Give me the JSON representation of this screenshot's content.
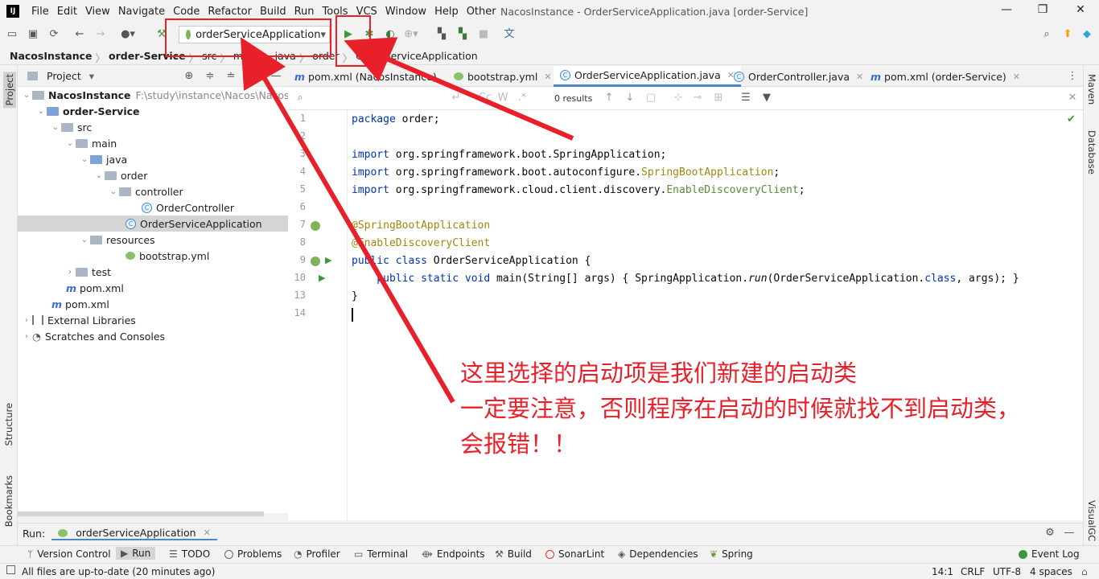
{
  "menubar": {
    "logo": "IJ",
    "items": [
      "File",
      "Edit",
      "View",
      "Navigate",
      "Code",
      "Refactor",
      "Build",
      "Run",
      "Tools",
      "VCS",
      "Window",
      "Help",
      "Other"
    ],
    "window_title": "NacosInstance - OrderServiceApplication.java [order-Service]",
    "minimize": "—",
    "maximize": "❐",
    "close": "✕"
  },
  "toolbar": {
    "run_config": "orderServiceApplication",
    "dropdown": "▾"
  },
  "navbar": {
    "crumbs": [
      "NacosInstance",
      "order-Service",
      "src",
      "main",
      "java",
      "order",
      "OrderServiceApplication"
    ]
  },
  "left_strip": {
    "project": "Project",
    "structure": "Structure",
    "bookmarks": "Bookmarks"
  },
  "project_panel": {
    "title": "Project",
    "dropdown": "▾",
    "tree": [
      {
        "label": "NacosInstance",
        "path": "F:\\study\\instance\\Nacos\\NacosInst"
      },
      {
        "label": "order-Service"
      },
      {
        "label": "src"
      },
      {
        "label": "main"
      },
      {
        "label": "java"
      },
      {
        "label": "order"
      },
      {
        "label": "controller"
      },
      {
        "label": "OrderController"
      },
      {
        "label": "OrderServiceApplication"
      },
      {
        "label": "resources"
      },
      {
        "label": "bootstrap.yml"
      },
      {
        "label": "test"
      },
      {
        "label": "pom.xml"
      },
      {
        "label": "pom.xml"
      },
      {
        "label": "External Libraries"
      },
      {
        "label": "Scratches and Consoles"
      }
    ]
  },
  "tabs": [
    {
      "label": "pom.xml (NacosInstance)"
    },
    {
      "label": "bootstrap.yml"
    },
    {
      "label": "OrderServiceApplication.java"
    },
    {
      "label": "OrderController.java"
    },
    {
      "label": "pom.xml (order-Service)"
    }
  ],
  "search": {
    "results": "0 results",
    "placeholder": ""
  },
  "editor": {
    "line_numbers": [
      "1",
      "2",
      "3",
      "4",
      "5",
      "6",
      "7",
      "8",
      "9",
      "10",
      "13",
      "14"
    ],
    "lines": {
      "l1_kw": "package",
      "l1_rest": " order;",
      "l3_kw": "import",
      "l3_rest": " org.springframework.boot.SpringApplication;",
      "l4_kw": "import",
      "l4_rest": " org.springframework.boot.autoconfigure.",
      "l4_cls": "SpringBootApplication",
      "l4_end": ";",
      "l5_kw": "import",
      "l5_rest": " org.springframework.cloud.client.discovery.",
      "l5_cls": "EnableDiscoveryClient",
      "l5_end": ";",
      "l7": "@SpringBootApplication",
      "l8": "@EnableDiscoveryClient",
      "l9_kw": "public class",
      "l9_rest": " OrderServiceApplication {",
      "l10_kw": "    public static void",
      "l10_a": " main(String[] args) { SpringApplication.",
      "l10_run": "run",
      "l10_b": "(OrderServiceApplication.",
      "l10_cls": "class",
      "l10_c": ", args); }",
      "l13": "}"
    }
  },
  "right_strip": {
    "maven": "Maven",
    "database": "Database",
    "visualgc": "VisualGC"
  },
  "run_bar": {
    "label": "Run:",
    "config": "orderServiceApplication"
  },
  "bottom_tools": [
    "Version Control",
    "Run",
    "TODO",
    "Problems",
    "Profiler",
    "Terminal",
    "Endpoints",
    "Build",
    "SonarLint",
    "Dependencies",
    "Spring",
    "Event Log"
  ],
  "status": {
    "message": "All files are up-to-date (20 minutes ago)",
    "position": "14:1",
    "line_sep": "CRLF",
    "encoding": "UTF-8",
    "indent": "4 spaces"
  },
  "annotation": {
    "line1": "这里选择的启动项是我们新建的启动类",
    "line2": "一定要注意，否则程序在启动的时候就找不到启动类，",
    "line3": "会报错！！",
    "color": "#e8202a"
  }
}
